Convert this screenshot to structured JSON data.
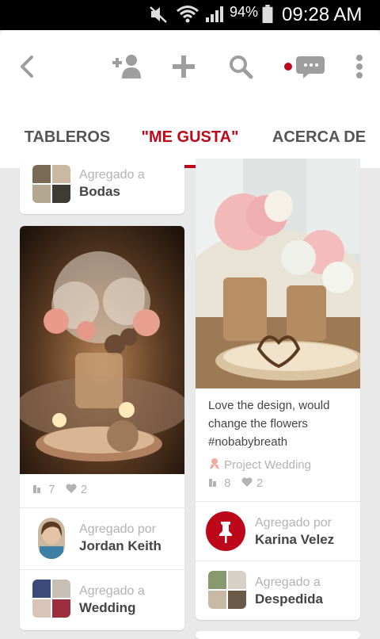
{
  "status_bar": {
    "battery_percent": "94%",
    "time": "09:28 AM",
    "icons": [
      "mute-icon",
      "wifi-icon",
      "signal-icon",
      "battery-icon"
    ]
  },
  "toolbar": {
    "icons": [
      "back-arrow-icon",
      "add-friend-icon",
      "plus-icon",
      "search-icon",
      "messages-icon",
      "more-icon"
    ],
    "notification_dot_color": "#bd081c"
  },
  "tabs": [
    {
      "label": "TABLEROS"
    },
    {
      "label": "\"ME GUSTA\""
    },
    {
      "label": "ACERCA DE"
    }
  ],
  "pins": {
    "left_top": {
      "added_label": "Agregado a",
      "board": "Bodas"
    },
    "left_main": {
      "repins": "7",
      "likes": "2",
      "added_by_label": "Agregado por",
      "user": "Jordan Keith",
      "added_to_label": "Agregado a",
      "board": "Wedding"
    },
    "right_main": {
      "description": "Love the design, would change the flowers #nobabybreath",
      "source": "Project Wedding",
      "repins": "8",
      "likes": "2",
      "added_by_label": "Agregado por",
      "user": "Karina Velez",
      "added_to_label": "Agregado a",
      "board": "Despedida"
    }
  },
  "colors": {
    "accent": "#bd081c",
    "background": "#e9e9e9"
  }
}
